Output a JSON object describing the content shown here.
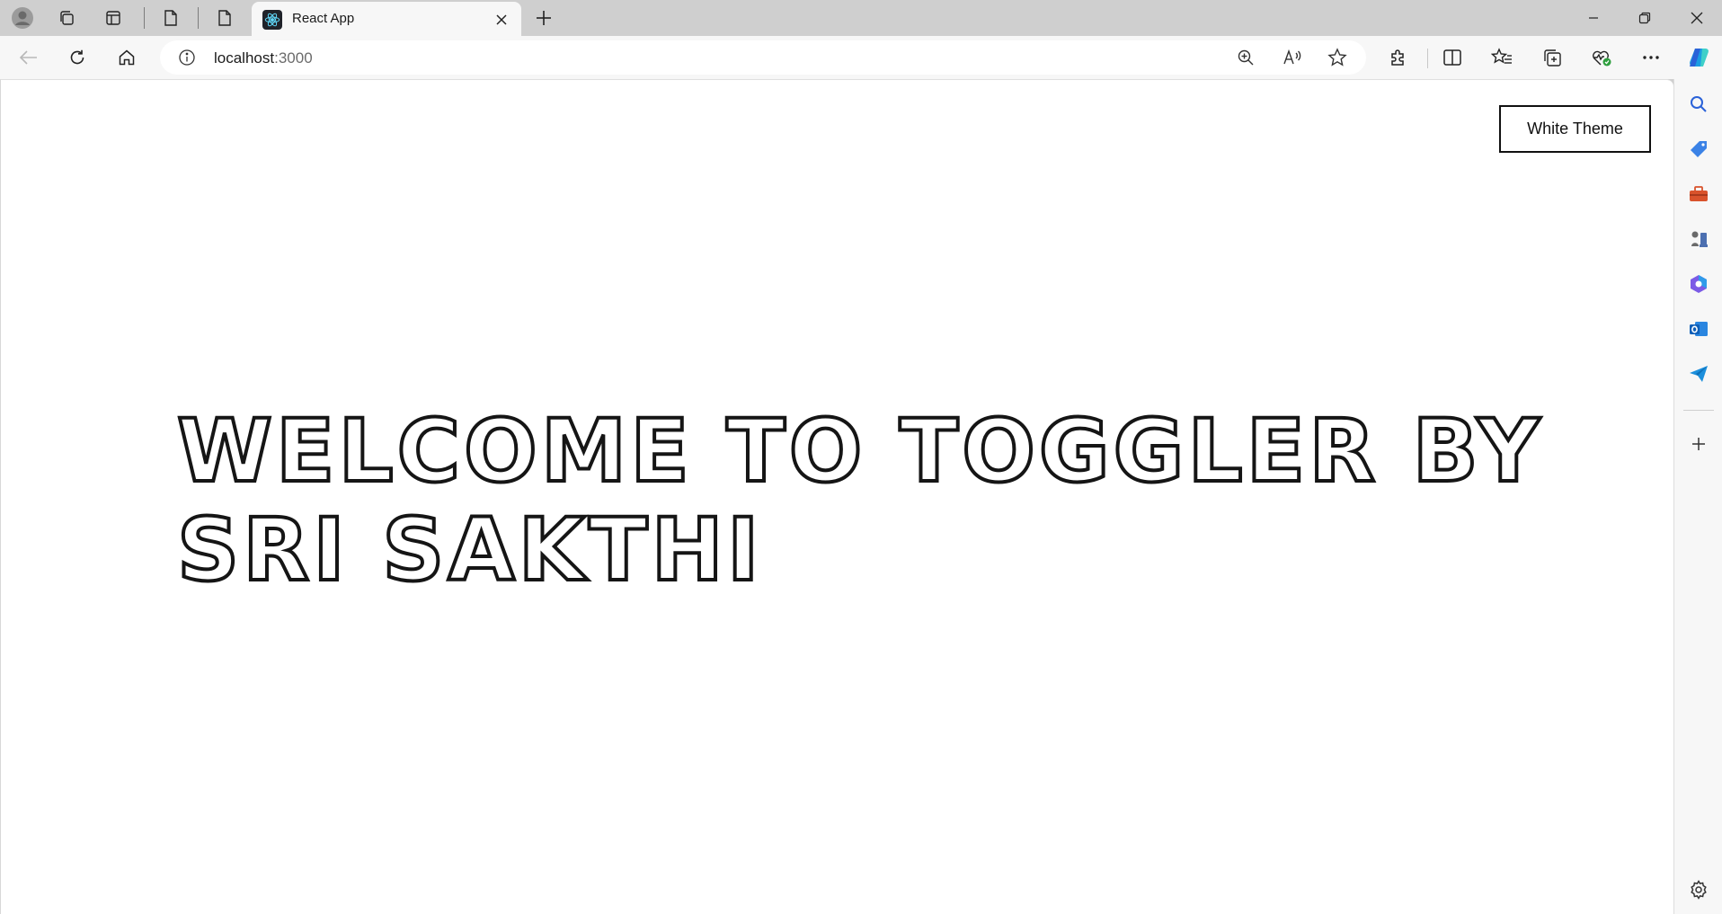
{
  "browser": {
    "tab": {
      "title": "React App",
      "favicon": "react-atom-icon"
    },
    "address_bar": {
      "host": "localhost",
      "port": ":3000"
    },
    "icons": {
      "profile": "profile-avatar-icon",
      "workspaces": "workspaces-icon",
      "tab_actions": "vertical-tabs-icon",
      "back": "back-arrow-icon",
      "refresh": "refresh-icon",
      "home": "home-icon",
      "site_info": "info-icon",
      "zoom": "zoom-in-icon",
      "read_aloud": "read-aloud-icon",
      "favorite": "star-icon",
      "extensions": "puzzle-icon",
      "split_screen": "split-screen-icon",
      "favorites": "favorites-icon",
      "collections": "collections-icon",
      "browser_essentials": "heart-pulse-icon",
      "more": "more-icon",
      "copilot": "copilot-icon"
    },
    "sidebar_icons": [
      "search-icon",
      "tag-icon",
      "toolbox-icon",
      "chess-icon",
      "office-icon",
      "outlook-icon",
      "send-icon",
      "add-icon",
      "settings-icon"
    ],
    "accent_color": "#0078d4"
  },
  "page": {
    "theme_button_label": "White Theme",
    "heading": "WELCOME TO TOGGLER BY SRI SAKTHI"
  }
}
